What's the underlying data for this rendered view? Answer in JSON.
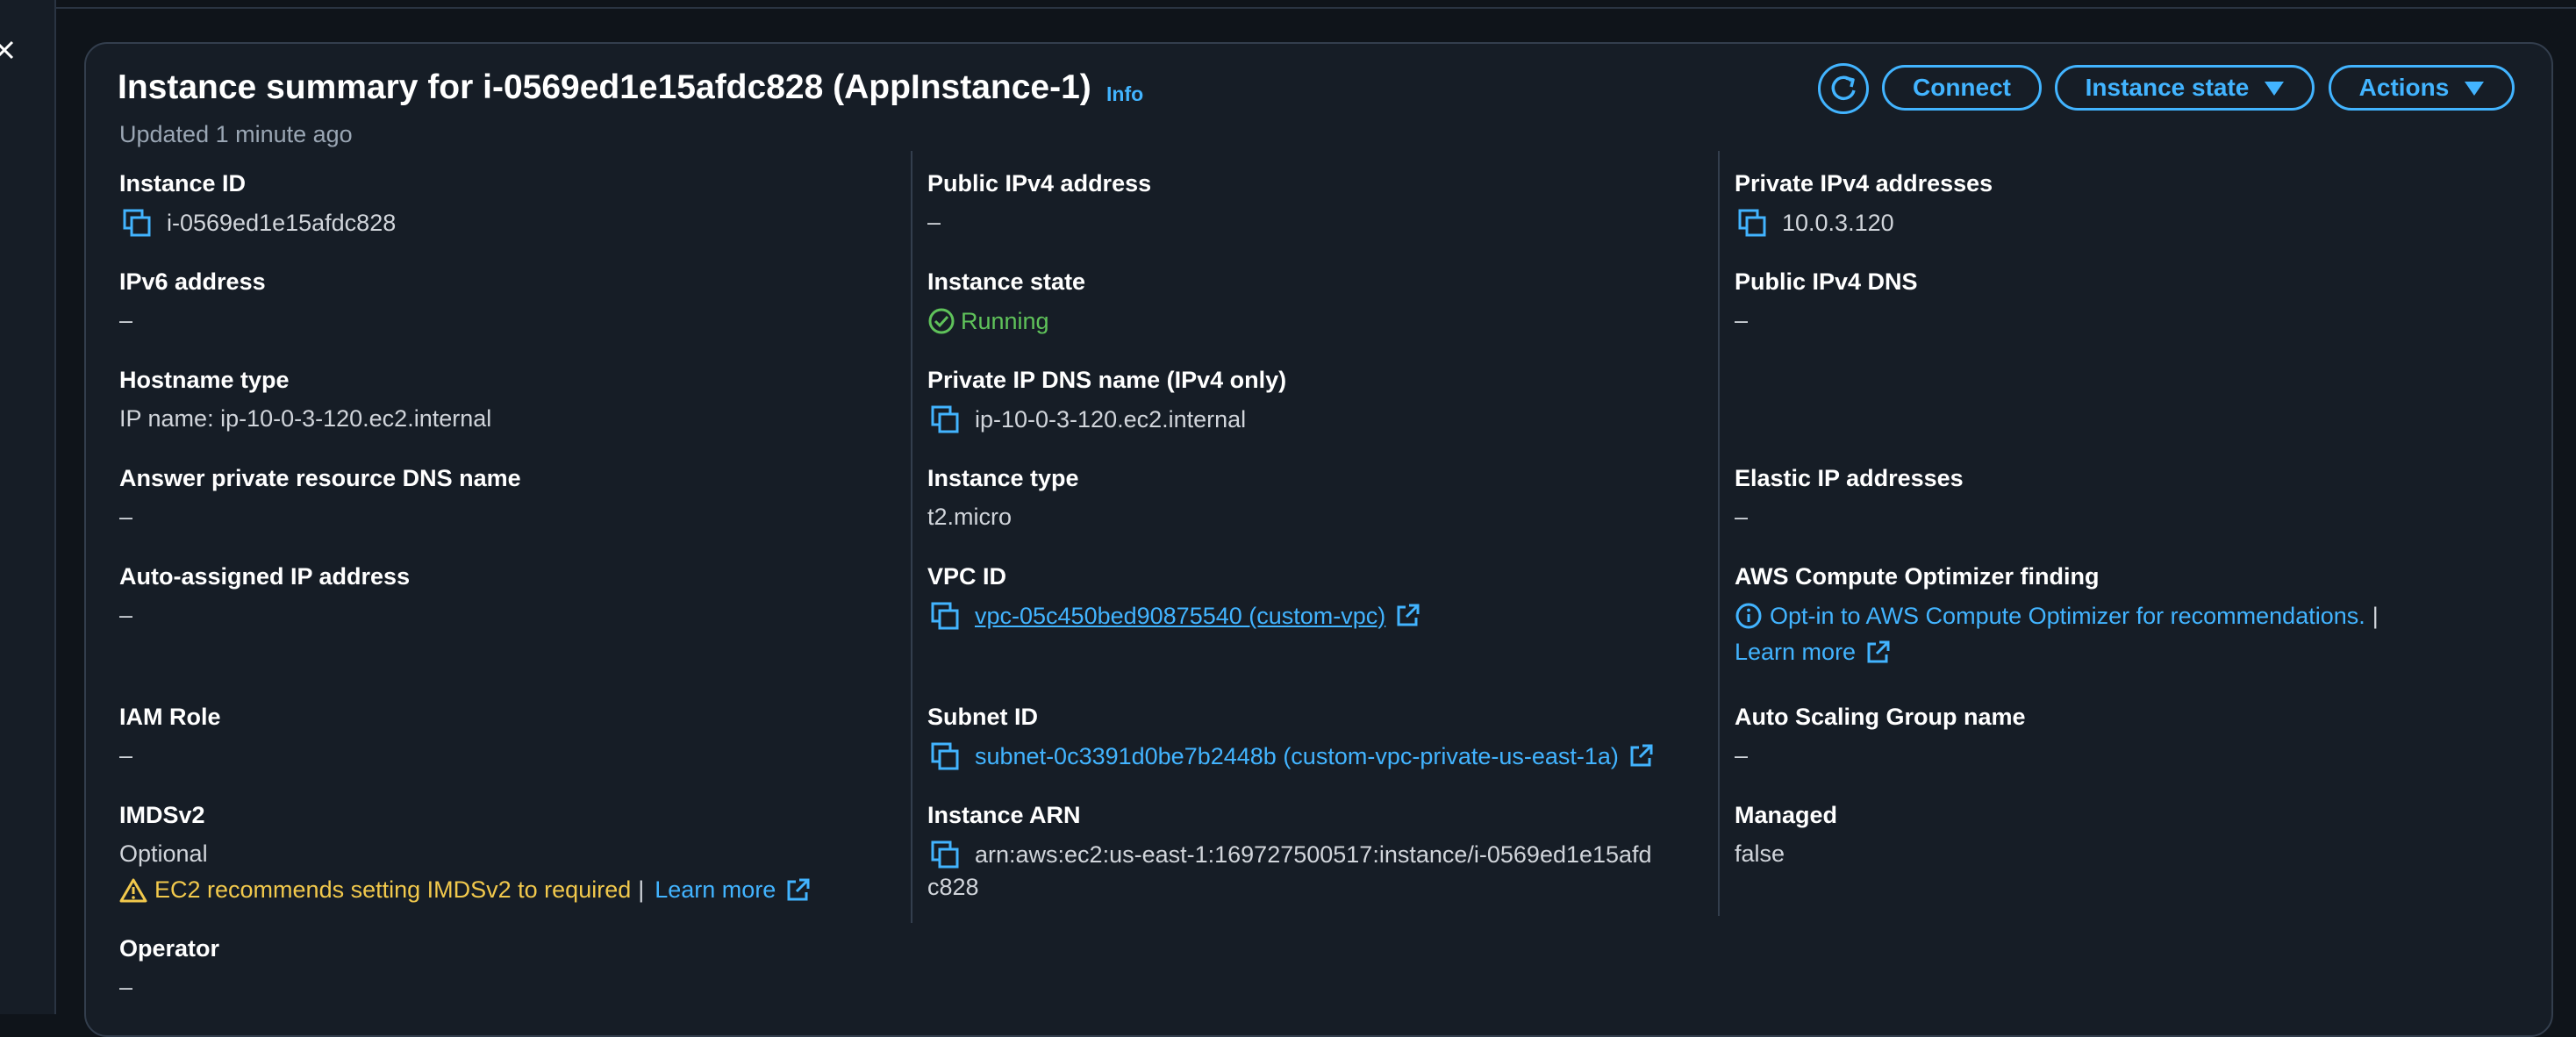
{
  "summary": {
    "title": "Instance summary for i-0569ed1e15afdc828 (AppInstance-1)",
    "info_label": "Info",
    "updated": "Updated 1 minute ago"
  },
  "buttons": {
    "connect": "Connect",
    "instance_state": "Instance state",
    "actions": "Actions"
  },
  "col1": {
    "instance_id_label": "Instance ID",
    "instance_id": "i-0569ed1e15afdc828",
    "ipv6_label": "IPv6 address",
    "ipv6": "–",
    "hostname_type_label": "Hostname type",
    "hostname_type": "IP name: ip-10-0-3-120.ec2.internal",
    "answer_dns_label": "Answer private resource DNS name",
    "answer_dns": "–",
    "auto_ip_label": "Auto-assigned IP address",
    "auto_ip": "–",
    "iam_label": "IAM Role",
    "iam": "–",
    "imdsv2_label": "IMDSv2",
    "imdsv2": "Optional",
    "imdsv2_warning": "EC2 recommends setting IMDSv2 to required",
    "imdsv2_sep": "|",
    "imdsv2_learn": "Learn more",
    "operator_label": "Operator",
    "operator": "–"
  },
  "col2": {
    "public_ipv4_label": "Public IPv4 address",
    "public_ipv4": "–",
    "state_label": "Instance state",
    "state": "Running",
    "private_dns_label": "Private IP DNS name (IPv4 only)",
    "private_dns": "ip-10-0-3-120.ec2.internal",
    "type_label": "Instance type",
    "type": "t2.micro",
    "vpc_label": "VPC ID",
    "vpc": "vpc-05c450bed90875540 (custom-vpc)",
    "subnet_label": "Subnet ID",
    "subnet": "subnet-0c3391d0be7b2448b (custom-vpc-private-us-east-1a)",
    "arn_label": "Instance ARN",
    "arn_line1": "arn:aws:ec2:us-east-1:169727500517:instance/i-0569ed1e15afd",
    "arn_line2": "c828"
  },
  "col3": {
    "private_ipv4_label": "Private IPv4 addresses",
    "private_ipv4": "10.0.3.120",
    "public_dns_label": "Public IPv4 DNS",
    "public_dns": "–",
    "elastic_label": "Elastic IP addresses",
    "elastic": "–",
    "optimizer_label": "AWS Compute Optimizer finding",
    "optimizer_link": "Opt-in to AWS Compute Optimizer for recommendations.",
    "optimizer_sep": "|",
    "optimizer_learn": "Learn more",
    "asg_label": "Auto Scaling Group name",
    "asg": "–",
    "managed_label": "Managed",
    "managed": "false"
  },
  "colors": {
    "accent": "#42b4ff",
    "running": "#5fc25a",
    "warning": "#f2c94c",
    "panel": "#161d26",
    "background": "#0f141a"
  },
  "icons": [
    "close-icon",
    "refresh-icon",
    "caret-down-icon",
    "copy-icon",
    "check-circle-icon",
    "external-link-icon",
    "info-circle-icon",
    "warning-icon"
  ]
}
